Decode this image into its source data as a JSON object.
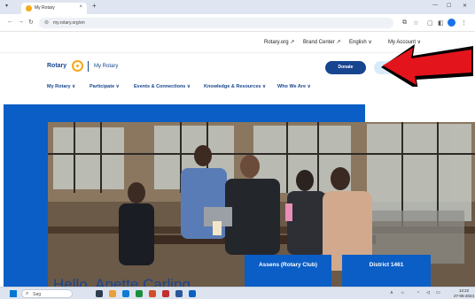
{
  "browser": {
    "tab_title": "My Rotary",
    "tab_close": "×",
    "new_tab": "+",
    "url": "my.rotary.org/en",
    "colors": {
      "tabstrip": "#dfe6f2",
      "accent": "#1a73e8"
    }
  },
  "utility_bar": {
    "links": [
      "Rotary.org ↗",
      "Brand Center ↗",
      "English ∨",
      "My Account ∨"
    ]
  },
  "header": {
    "logo_text": "Rotary",
    "my_rotary": "My Rotary",
    "donate_label": "Donate",
    "nav": [
      "My Rotary ∨",
      "Participate ∨",
      "Events & Connections ∨",
      "Knowledge & Resources ∨",
      "Who We Are ∨"
    ]
  },
  "hero": {
    "greeting": "Hello, Anette Carling",
    "cards": [
      "Assens (Rotary Club)",
      "District 1461"
    ]
  },
  "taskbar": {
    "search_placeholder": "Søg",
    "time": "13:22",
    "date": "27-05-2024"
  },
  "colors": {
    "rotary_blue": "#17458f",
    "hero_blue": "#0b5ec5",
    "rotary_gold": "#f7a81b",
    "annotation_arrow": "#e3141b"
  }
}
